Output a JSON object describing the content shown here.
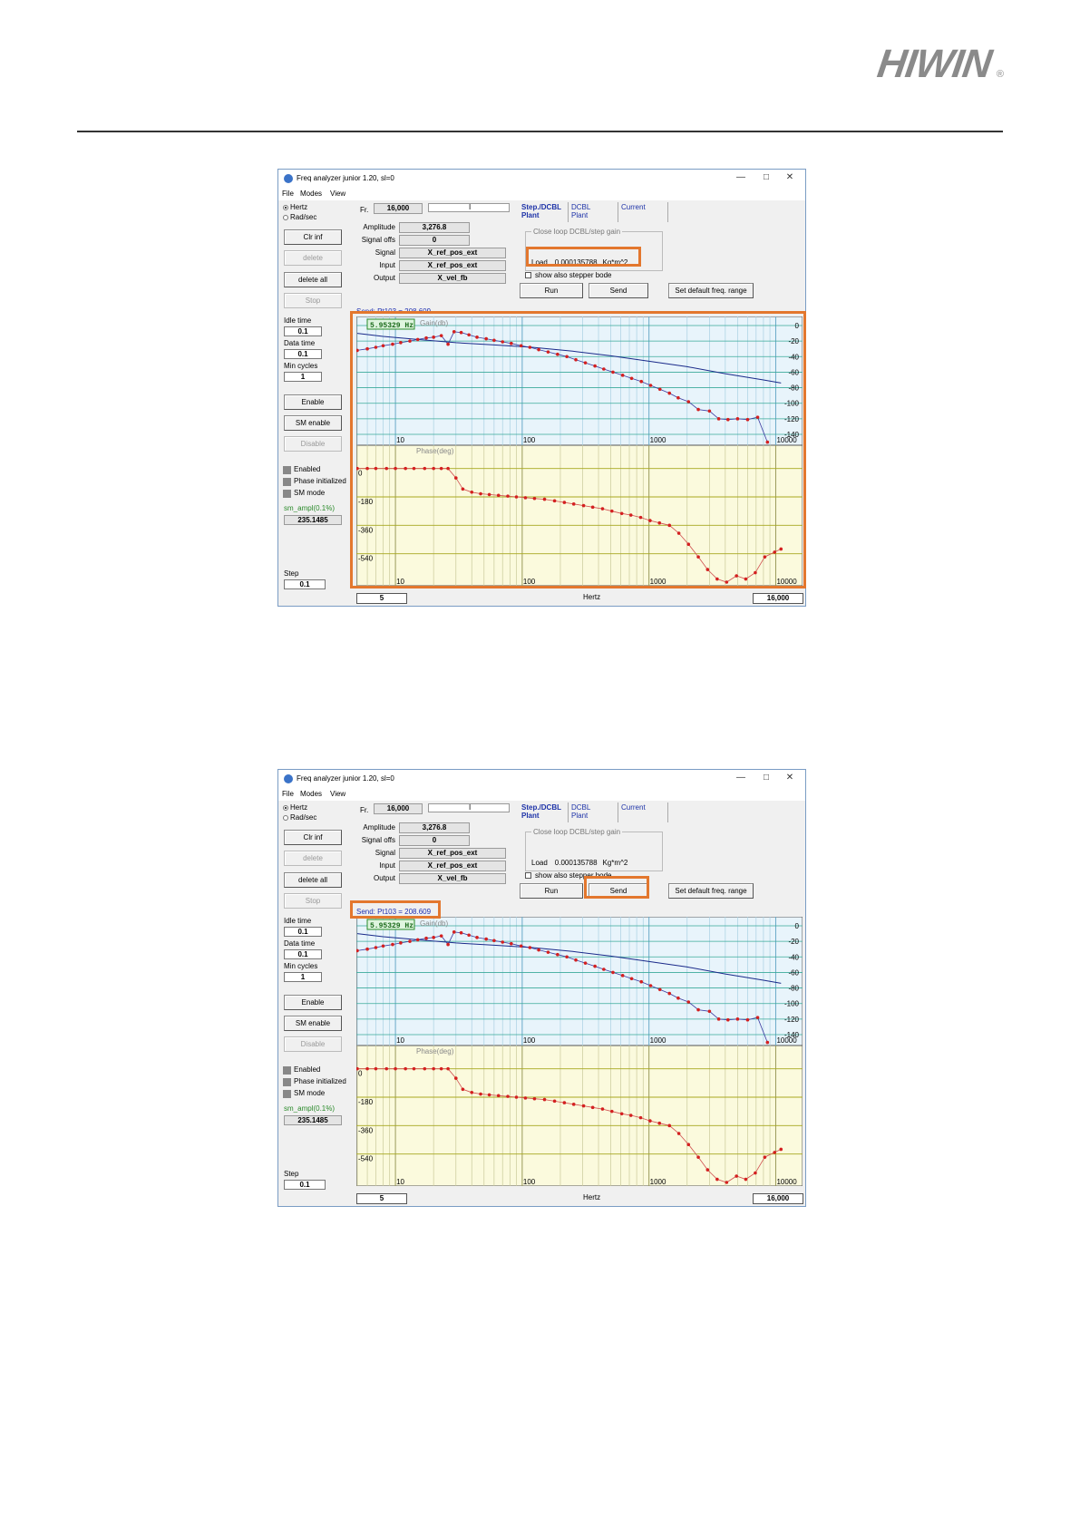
{
  "header": {
    "logo": "HIWIN",
    "logo_mark": "®"
  },
  "screenshots": [
    {
      "window": {
        "title": "Freq analyzer junior 1.20, sl=0",
        "menu": [
          "File",
          "Modes",
          "View"
        ]
      },
      "left_panel": {
        "units": [
          {
            "label": "Hertz",
            "selected": true
          },
          {
            "label": "Rad/sec",
            "selected": false
          }
        ],
        "clr_inf": "Clr inf",
        "delete": "delete",
        "delete_all": "delete all",
        "stop": "Stop",
        "idle_time_label": "Idle time",
        "idle_time": "0.1",
        "data_time_label": "Data time",
        "data_time": "0.1",
        "min_cycles_label": "Min cycles",
        "min_cycles": "1",
        "enable": "Enable",
        "sm_enable": "SM enable",
        "disable": "Disable",
        "status": [
          "Enabled",
          "Phase initialized",
          "SM mode"
        ],
        "sm_ampl_label": "sm_ampl(0.1%)",
        "sm_ampl": "235.1485",
        "step_label": "Step",
        "step": "0.1"
      },
      "params": {
        "fr_label": "Fr.",
        "fr": "16,000",
        "fr_marker": "I",
        "amplitude_label": "Amplitude",
        "amplitude": "3,276.8",
        "signal_offs_label": "Signal offs",
        "signal_offs": "0",
        "signal_label": "Signal",
        "signal": "X_ref_pos_ext",
        "input_label": "Input",
        "input": "X_ref_pos_ext",
        "output_label": "Output",
        "output": "X_vel_fb"
      },
      "tabs": [
        {
          "line1": "Step./DCBL",
          "line2": "Plant"
        },
        {
          "line1": "DCBL",
          "line2": "Plant"
        },
        {
          "line1": "Current",
          "line2": ""
        }
      ],
      "gain_group": {
        "title": "Close loop DCBL/step  gain",
        "load_label": "Load",
        "load_value": "0.000135788",
        "load_unit": "Kg*m^2"
      },
      "show_stepper": "show also stepper bode",
      "run": "Run",
      "send": "Send",
      "set_default": "Set default freq. range",
      "send_status": "Send: Pt103 = 208.609",
      "freq_min": "5",
      "freq_axis": "Hertz",
      "freq_max": "16,000"
    },
    {
      "window": {
        "title": "Freq analyzer junior 1.20, sl=0",
        "menu": [
          "File",
          "Modes",
          "View"
        ]
      },
      "left_panel": {
        "units": [
          {
            "label": "Hertz",
            "selected": true
          },
          {
            "label": "Rad/sec",
            "selected": false
          }
        ],
        "clr_inf": "Clr inf",
        "delete": "delete",
        "delete_all": "delete all",
        "stop": "Stop",
        "idle_time_label": "Idle time",
        "idle_time": "0.1",
        "data_time_label": "Data time",
        "data_time": "0.1",
        "min_cycles_label": "Min cycles",
        "min_cycles": "1",
        "enable": "Enable",
        "sm_enable": "SM enable",
        "disable": "Disable",
        "status": [
          "Enabled",
          "Phase initialized",
          "SM mode"
        ],
        "sm_ampl_label": "sm_ampl(0.1%)",
        "sm_ampl": "235.1485",
        "step_label": "Step",
        "step": "0.1"
      },
      "params": {
        "fr_label": "Fr.",
        "fr": "16,000",
        "fr_marker": "I",
        "amplitude_label": "Amplitude",
        "amplitude": "3,276.8",
        "signal_offs_label": "Signal offs",
        "signal_offs": "0",
        "signal_label": "Signal",
        "signal": "X_ref_pos_ext",
        "input_label": "Input",
        "input": "X_ref_pos_ext",
        "output_label": "Output",
        "output": "X_vel_fb"
      },
      "tabs": [
        {
          "line1": "Step./DCBL",
          "line2": "Plant"
        },
        {
          "line1": "DCBL",
          "line2": "Plant"
        },
        {
          "line1": "Current",
          "line2": ""
        }
      ],
      "gain_group": {
        "title": "Close loop DCBL/step  gain",
        "load_label": "Load",
        "load_value": "0.000135788",
        "load_unit": "Kg*m^2"
      },
      "show_stepper": "show also stepper bode",
      "run": "Run",
      "send": "Send",
      "set_default": "Set default freq. range",
      "send_status": "Send: Pt103 = 208.609",
      "freq_min": "5",
      "freq_axis": "Hertz",
      "freq_max": "16,000"
    }
  ],
  "chart_data": {
    "type": "line",
    "cursor_readout": "5.95329 Hz",
    "gain": {
      "label": "Gain(db)",
      "yticks": [
        "0",
        "-20",
        "-40",
        "-60",
        "-80",
        "-100",
        "-120",
        "-140"
      ],
      "ylim": [
        -140,
        0
      ],
      "measured": [
        [
          5,
          -32
        ],
        [
          6,
          -30
        ],
        [
          7,
          -28
        ],
        [
          8,
          -26
        ],
        [
          9.5,
          -24
        ],
        [
          11,
          -22
        ],
        [
          13,
          -20
        ],
        [
          15,
          -18
        ],
        [
          17.5,
          -16
        ],
        [
          20,
          -15
        ],
        [
          23,
          -13
        ],
        [
          26,
          -24
        ],
        [
          29,
          -8
        ],
        [
          33,
          -9
        ],
        [
          38,
          -12
        ],
        [
          44,
          -15
        ],
        [
          52,
          -17
        ],
        [
          60,
          -19
        ],
        [
          70,
          -21
        ],
        [
          82,
          -23
        ],
        [
          98,
          -26
        ],
        [
          115,
          -28
        ],
        [
          135,
          -31
        ],
        [
          160,
          -34
        ],
        [
          190,
          -37
        ],
        [
          225,
          -40
        ],
        [
          265,
          -44
        ],
        [
          315,
          -48
        ],
        [
          375,
          -52
        ],
        [
          440,
          -56
        ],
        [
          520,
          -60
        ],
        [
          620,
          -64
        ],
        [
          730,
          -68
        ],
        [
          870,
          -72
        ],
        [
          1030,
          -77
        ],
        [
          1220,
          -82
        ],
        [
          1450,
          -87
        ],
        [
          1700,
          -93
        ],
        [
          2050,
          -98
        ],
        [
          2450,
          -108
        ],
        [
          3000,
          -110
        ],
        [
          3550,
          -120
        ],
        [
          4200,
          -121
        ],
        [
          5000,
          -120
        ],
        [
          6000,
          -121
        ],
        [
          7200,
          -118
        ],
        [
          8600,
          -150
        ]
      ],
      "model": [
        [
          5,
          -10
        ],
        [
          8,
          -14
        ],
        [
          15,
          -18
        ],
        [
          30,
          -22
        ],
        [
          60,
          -25
        ],
        [
          120,
          -28
        ],
        [
          250,
          -33
        ],
        [
          500,
          -39
        ],
        [
          1000,
          -46
        ],
        [
          2000,
          -53
        ],
        [
          4000,
          -62
        ],
        [
          8000,
          -70
        ],
        [
          11000,
          -74
        ]
      ],
      "series_colors": {
        "measured": "#d42020",
        "model": "#1a2a8a"
      }
    },
    "phase": {
      "label": "Phase(deg)",
      "yticks": [
        "0",
        "-180",
        "-360",
        "-540"
      ],
      "ylim": [
        -720,
        90
      ],
      "measured": [
        [
          5,
          0
        ],
        [
          6,
          0
        ],
        [
          7,
          0
        ],
        [
          8.5,
          0
        ],
        [
          10,
          0
        ],
        [
          12,
          0
        ],
        [
          14,
          0
        ],
        [
          17,
          0
        ],
        [
          20,
          0
        ],
        [
          23,
          0
        ],
        [
          26,
          0
        ],
        [
          30,
          -60
        ],
        [
          34,
          -130
        ],
        [
          40,
          -150
        ],
        [
          47,
          -160
        ],
        [
          55,
          -165
        ],
        [
          65,
          -170
        ],
        [
          77,
          -175
        ],
        [
          90,
          -180
        ],
        [
          106,
          -185
        ],
        [
          125,
          -190
        ],
        [
          150,
          -195
        ],
        [
          180,
          -205
        ],
        [
          215,
          -215
        ],
        [
          255,
          -225
        ],
        [
          305,
          -235
        ],
        [
          360,
          -245
        ],
        [
          430,
          -255
        ],
        [
          510,
          -270
        ],
        [
          610,
          -285
        ],
        [
          720,
          -295
        ],
        [
          860,
          -310
        ],
        [
          1020,
          -330
        ],
        [
          1210,
          -345
        ],
        [
          1450,
          -360
        ],
        [
          1720,
          -410
        ],
        [
          2050,
          -480
        ],
        [
          2450,
          -560
        ],
        [
          2900,
          -640
        ],
        [
          3450,
          -700
        ],
        [
          4100,
          -720
        ],
        [
          4900,
          -680
        ],
        [
          5800,
          -700
        ],
        [
          6900,
          -660
        ],
        [
          8200,
          -560
        ],
        [
          9800,
          -530
        ],
        [
          11000,
          -510
        ]
      ],
      "series_colors": {
        "measured": "#d42020"
      }
    },
    "xaxis": {
      "scale": "log",
      "xlim": [
        5,
        16000
      ],
      "ticks": [
        "10",
        "100",
        "1000",
        "10000"
      ],
      "label": "Hertz"
    }
  }
}
